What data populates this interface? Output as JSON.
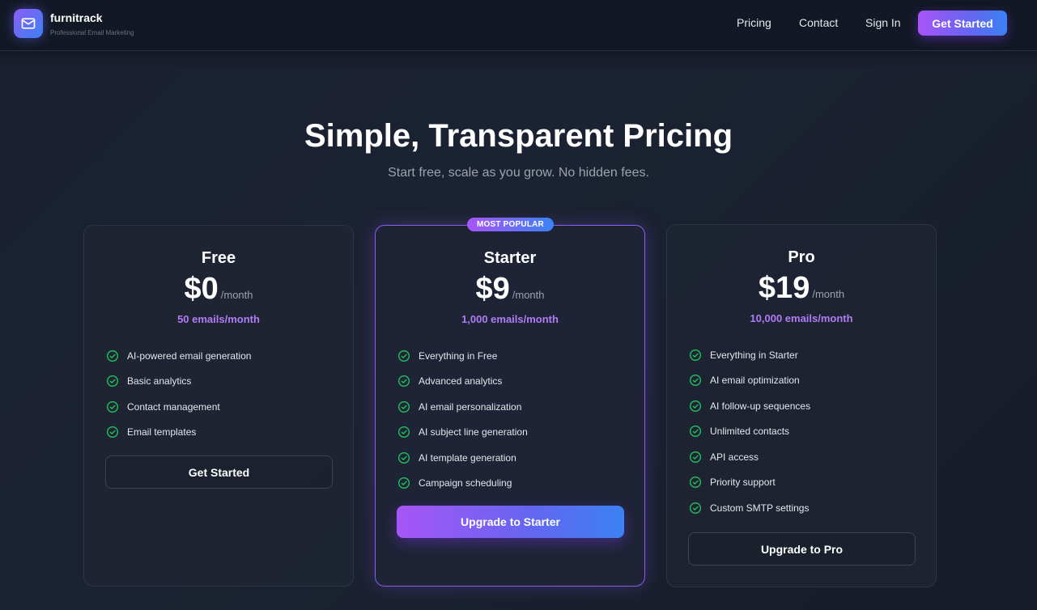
{
  "brand": {
    "name": "furnitrack",
    "tagline": "Professional Email Marketing",
    "logo_icon": "mail-icon"
  },
  "nav": {
    "pricing": "Pricing",
    "contact": "Contact",
    "sign_in": "Sign In",
    "cta": "Get Started"
  },
  "hero": {
    "title": "Simple, Transparent Pricing",
    "subtitle": "Start free, scale as you grow. No hidden fees."
  },
  "plans": [
    {
      "name": "Free",
      "price": "$0",
      "period": "/month",
      "quota": "50 emails/month",
      "features": [
        "AI-powered email generation",
        "Basic analytics",
        "Contact management",
        "Email templates"
      ],
      "button": "Get Started"
    },
    {
      "name": "Starter",
      "badge": "MOST POPULAR",
      "price": "$9",
      "period": "/month",
      "quota": "1,000 emails/month",
      "features": [
        "Everything in Free",
        "Advanced analytics",
        "AI email personalization",
        "AI subject line generation",
        "AI template generation",
        "Campaign scheduling"
      ],
      "button": "Upgrade to Starter"
    },
    {
      "name": "Pro",
      "price": "$19",
      "period": "/month",
      "quota": "10,000 emails/month",
      "features": [
        "Everything in Starter",
        "AI email optimization",
        "AI follow-up sequences",
        "Unlimited contacts",
        "API access",
        "Priority support",
        "Custom SMTP settings"
      ],
      "button": "Upgrade to Pro"
    }
  ],
  "colors": {
    "accent_purple": "#a855f7",
    "accent_blue": "#3b82f6",
    "quota_text": "#b07cf7",
    "check_green": "#22c55e",
    "background": "#1a2030"
  }
}
